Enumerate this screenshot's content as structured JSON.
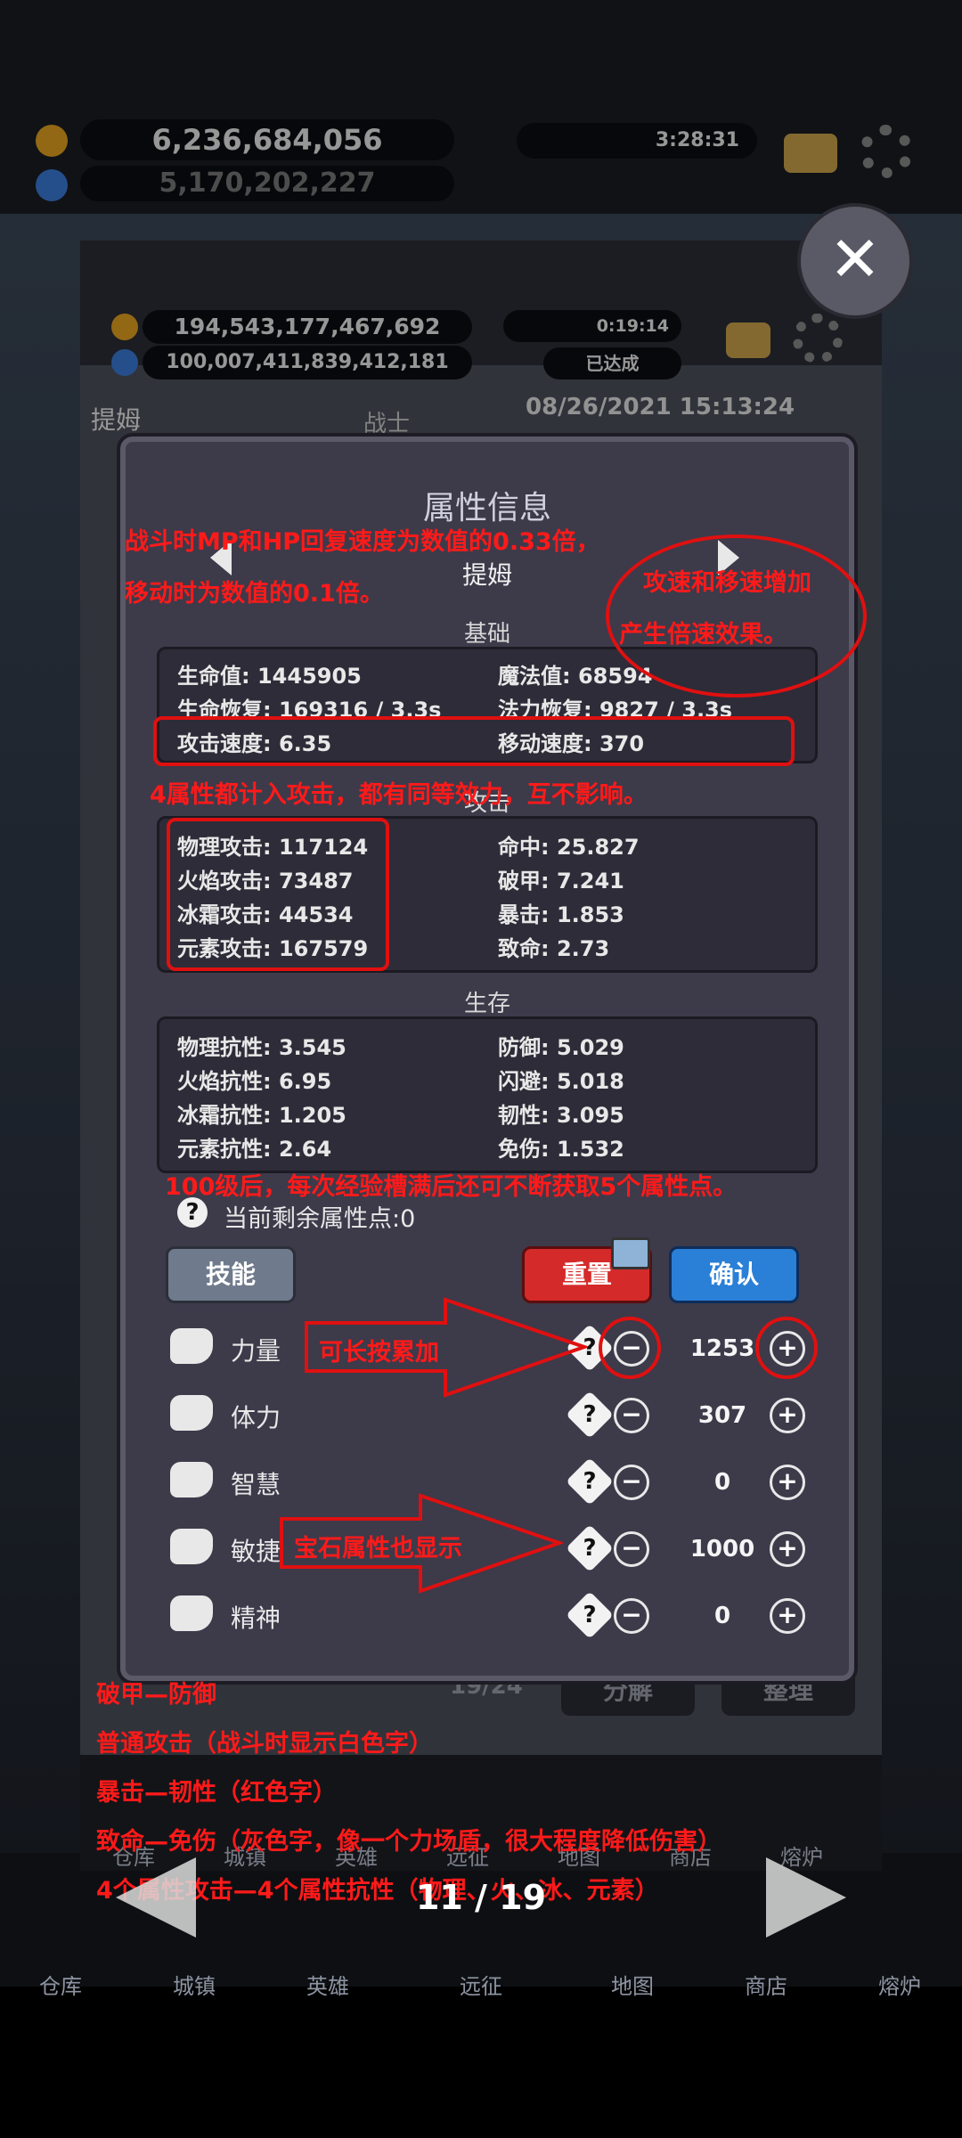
{
  "outer_header": {
    "gold": "6,236,684,056",
    "gems": "5,170,202,227",
    "timer": "3:28:31"
  },
  "inner_header": {
    "gold": "194,543,177,467,692",
    "gems": "100,007,411,839,412,181",
    "timer": "0:19:14",
    "achieved": "已达成",
    "hero_name": "提姆",
    "hero_class": "战士",
    "datetime": "08/26/2021 15:13:24"
  },
  "panel": {
    "title": "属性信息",
    "hero": "提姆",
    "basic": {
      "title": "基础",
      "hp_label": "生命值:",
      "hp": "1445905",
      "mp_label": "魔法值:",
      "mp": "68594",
      "hp_regen_label": "生命恢复:",
      "hp_regen": "169316 / 3.3s",
      "mp_regen_label": "法力恢复:",
      "mp_regen": "9827 / 3.3s",
      "atk_speed_label": "攻击速度:",
      "atk_speed": "6.35",
      "move_speed_label": "移动速度:",
      "move_speed": "370"
    },
    "attack": {
      "title": "攻击",
      "rows": [
        {
          "l1": "物理攻击:",
          "v1": "117124",
          "l2": "命中:",
          "v2": "25.827"
        },
        {
          "l1": "火焰攻击:",
          "v1": "73487",
          "l2": "破甲:",
          "v2": "7.241"
        },
        {
          "l1": "冰霜攻击:",
          "v1": "44534",
          "l2": "暴击:",
          "v2": "1.853"
        },
        {
          "l1": "元素攻击:",
          "v1": "167579",
          "l2": "致命:",
          "v2": "2.73"
        }
      ]
    },
    "survive": {
      "title": "生存",
      "rows": [
        {
          "l1": "物理抗性:",
          "v1": "3.545",
          "l2": "防御:",
          "v2": "5.029"
        },
        {
          "l1": "火焰抗性:",
          "v1": "6.95",
          "l2": "闪避:",
          "v2": "5.018"
        },
        {
          "l1": "冰霜抗性:",
          "v1": "1.205",
          "l2": "韧性:",
          "v2": "3.095"
        },
        {
          "l1": "元素抗性:",
          "v1": "2.64",
          "l2": "免伤:",
          "v2": "1.532"
        }
      ]
    },
    "remaining": "当前剩余属性点:0",
    "skill_button": "技能",
    "reset_button": "重置",
    "confirm_button": "确认",
    "attributes": [
      {
        "name": "力量",
        "value": "1253"
      },
      {
        "name": "体力",
        "value": "307"
      },
      {
        "name": "智慧",
        "value": "0"
      },
      {
        "name": "敏捷",
        "value": "1000"
      },
      {
        "name": "精神",
        "value": "0"
      }
    ],
    "question": "?",
    "plus": "+",
    "minus": "−"
  },
  "inventory": {
    "count": "19/24",
    "decompose": "分解",
    "sort": "整理"
  },
  "inner_nav": [
    "仓库",
    "城镇",
    "英雄",
    "远征",
    "地图",
    "商店",
    "熔炉"
  ],
  "outer_nav": [
    "仓库",
    "城镇",
    "英雄",
    "远征",
    "地图",
    "商店",
    "熔炉"
  ],
  "pager": {
    "page": "11 / 19"
  },
  "annotations": {
    "regen_note_1": "战斗时MP和HP回复速度为数值的0.33倍，",
    "regen_note_2": "移动时为数值的0.1倍。",
    "speed_note_1": "攻速和移速增加",
    "speed_note_2": "产生倍速效果。",
    "attack_note": "4属性都计入攻击，都有同等效力，互不影响。",
    "level_note": "100级后，每次经验槽满后还可不断获取5个属性点。",
    "hold_note": "可长按累加",
    "gem_note": "宝石属性也显示",
    "bottom_1": "破甲—防御",
    "bottom_2": "普通攻击（战斗时显示白色字）",
    "bottom_3": "暴击—韧性（红色字）",
    "bottom_4": "致命—免伤（灰色字，像一个力场盾，很大程度降低伤害）",
    "bottom_5": "4个属性攻击—4个属性抗性（物理、火、冰、元素）"
  },
  "colors": {
    "annotation": "#ff1a1a",
    "reset": "#d42a2a",
    "confirm": "#2a7fd6",
    "skill": "#6f7a8c"
  }
}
